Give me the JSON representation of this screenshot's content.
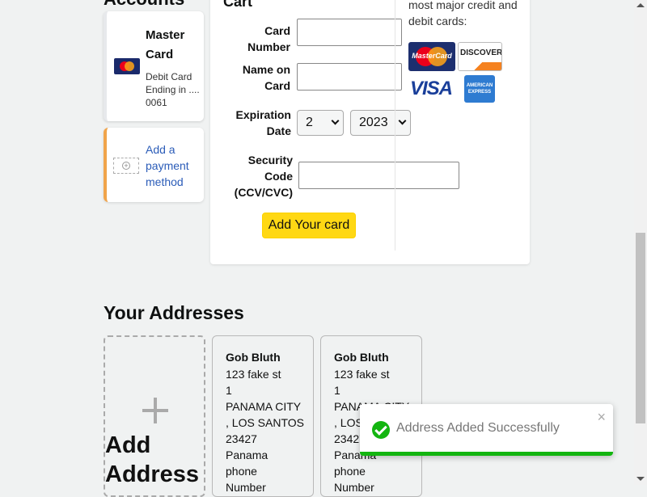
{
  "payments": {
    "heading": "Accounts",
    "card": {
      "name": "Master Card",
      "description": "Debit Card Ending in .... 0061"
    },
    "add_label": "Add a payment method"
  },
  "form": {
    "title": "Cart",
    "card_number_label": "Card Number",
    "name_label": "Name on Card",
    "exp_label": "Expiration Date",
    "exp_month": "2",
    "exp_year": "2023",
    "cvv_label": "Security Code (CCV/CVC)",
    "add_button": "Add Your card",
    "accepted_text": "most major credit and debit cards:",
    "logos": {
      "mastercard": "MasterCard",
      "discover": "DISCOVER",
      "visa": "VISA",
      "amex": "AMERICAN EXPRESS"
    }
  },
  "addresses": {
    "heading": "Your Addresses",
    "add_label": "Add Address",
    "cards": [
      {
        "name": "Gob Bluth",
        "lines": "123 fake st\n1\nPANAMA CITY\n, LOS SANTOS\n23427\nPanama\nphone\nNumber"
      },
      {
        "name": "Gob Bluth",
        "lines": "123 fake st\n1\nPANAMA CITY\n, LOS SANTOS\n23427\nPanama\nphone\nNumber"
      }
    ]
  },
  "toast": {
    "message": "Address Added Successfully",
    "close": "×",
    "progress": 1.0
  },
  "colors": {
    "accent_button": "#ffd814",
    "success": "#13b510",
    "link": "#2b5cb8",
    "add_border": "#f0a44a"
  }
}
